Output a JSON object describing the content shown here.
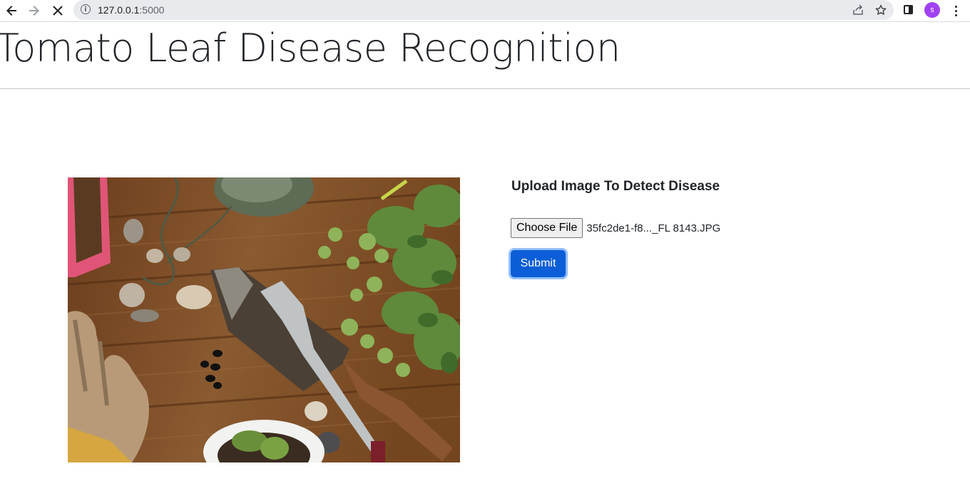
{
  "browser": {
    "url_host": "127.0.0.1",
    "url_port": ":5000",
    "profile_initial": "s"
  },
  "page": {
    "title": "Tomato Leaf Disease Recognition"
  },
  "upload": {
    "heading": "Upload Image To Detect Disease",
    "choose_file_label": "Choose File",
    "selected_file": "35fc2de1-f8..._FL 8143.JPG",
    "submit_label": "Submit"
  },
  "colors": {
    "accent": "#0b5ed7",
    "avatar": "#a142f4"
  },
  "icons": [
    "back-icon",
    "forward-icon",
    "stop-icon",
    "info-icon",
    "share-icon",
    "star-icon",
    "side-panel-icon",
    "more-icon"
  ]
}
